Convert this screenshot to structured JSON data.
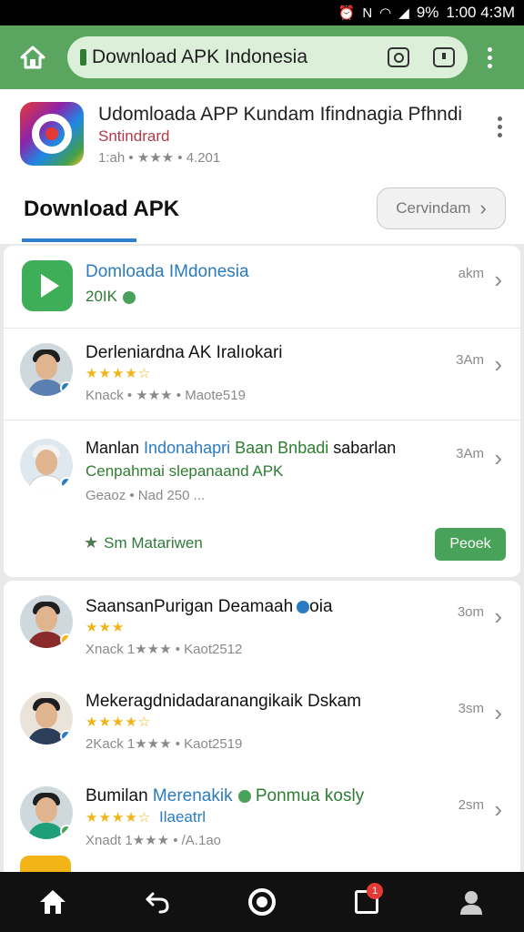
{
  "status_bar": {
    "battery": "9%",
    "time": "1:00 4:3M"
  },
  "browser": {
    "url": "Download APK Indonesia"
  },
  "app": {
    "title": "Udomloada APP Kundam Ifindnagia Pfhndi",
    "subtitle": "Sntindrard",
    "meta": "1:ah • ★★★ • 4.201",
    "section_title": "Download APK",
    "chip_label": "Cervindam"
  },
  "list_card1": [
    {
      "title": "Domloada IMdonesia",
      "line2": "20IK",
      "meta": "",
      "time": "akm"
    },
    {
      "title": "Derleniardna AK Iralıokari",
      "stars": "★★★★☆",
      "meta": "Knack • ★★★ • Maote519",
      "time": "3Am"
    },
    {
      "title_a": "Manlan ",
      "title_b": "Indonahapri",
      "title_c": " Baan Bnbadi",
      "title_d": " sabarlan",
      "line2": "Cenpahmai slepanaand APK",
      "meta": "Geaoz • Nad 250 ...",
      "time": "3Am"
    }
  ],
  "card1_footer": {
    "link": "Sm Matariwen",
    "button": "Peoek"
  },
  "list_card2": [
    {
      "title": "SaansanPurigan Deamaah",
      "title_tail": "oia",
      "stars": "★★★",
      "meta": "Xnack 1★★★ • Kaot2512",
      "time": "3om"
    },
    {
      "title": "Mekeragdnidadaranangikaik Dskam",
      "stars": "★★★★☆",
      "meta": "2Kack 1★★★ • Kaot2519",
      "time": "3sm"
    },
    {
      "title_a": "Bumilan ",
      "title_b": "Merenakik",
      "title_c": " Ponmua kosly",
      "line2": "Ilaeatrl",
      "stars": "★★★★☆",
      "meta": "Xnadt 1★★★ • /A.1ao",
      "time": "2sm"
    }
  ],
  "colors": {
    "accent_green": "#5aa55f",
    "link_blue": "#2a7bbf",
    "star": "#f2b417",
    "notif": "#e53935"
  },
  "bottom_nav": {
    "notif_count": "1"
  }
}
